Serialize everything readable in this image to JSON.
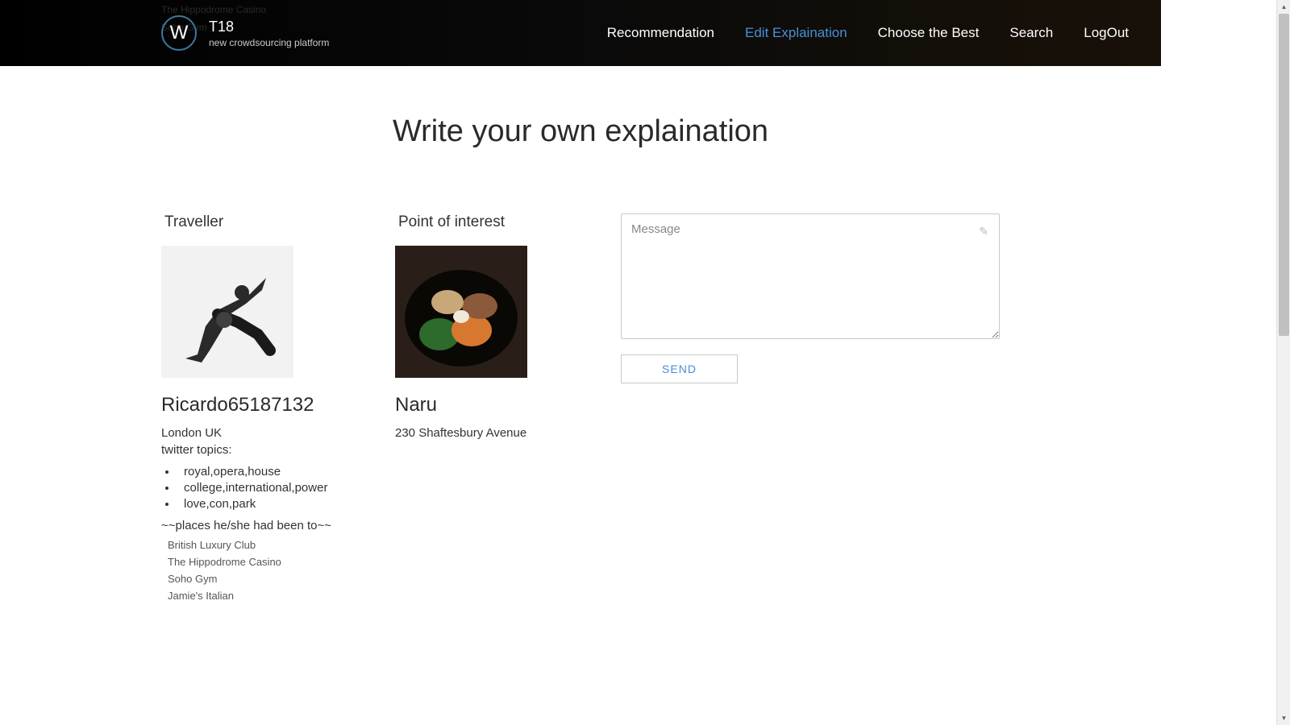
{
  "header": {
    "logo_letter": "W",
    "brand_title": "T18",
    "brand_sub": "new crowdsourcing platform",
    "nav": {
      "recommendation": "Recommendation",
      "edit": "Edit Explaination",
      "choose": "Choose the Best",
      "search": "Search",
      "logout": "LogOut"
    },
    "active_nav": "edit",
    "ghost_line1": "The Hippodrome Casino",
    "ghost_line2": "Soho Gym"
  },
  "page_title": "Write your own explaination",
  "traveller": {
    "label": "Traveller",
    "image_semantic": "dancer-breakdance-bw",
    "name": "Ricardo65187132",
    "location": "London UK",
    "topics_label": "twitter topics:",
    "topics": [
      "royal,opera,house",
      "college,international,power",
      "love,con,park"
    ],
    "places_label": "~~places he/she had been to~~",
    "places": [
      "British Luxury Club",
      "The Hippodrome Casino",
      "Soho Gym",
      "Jamie's Italian"
    ]
  },
  "poi": {
    "label": "Point of interest",
    "image_semantic": "korean-food-bibimbap",
    "name": "Naru",
    "address": "230 Shaftesbury Avenue"
  },
  "form": {
    "placeholder": "Message",
    "send_label": "SEND",
    "icon": "pencil-icon"
  },
  "colors": {
    "accent": "#4a8fd8",
    "header_bg": "#000000"
  }
}
